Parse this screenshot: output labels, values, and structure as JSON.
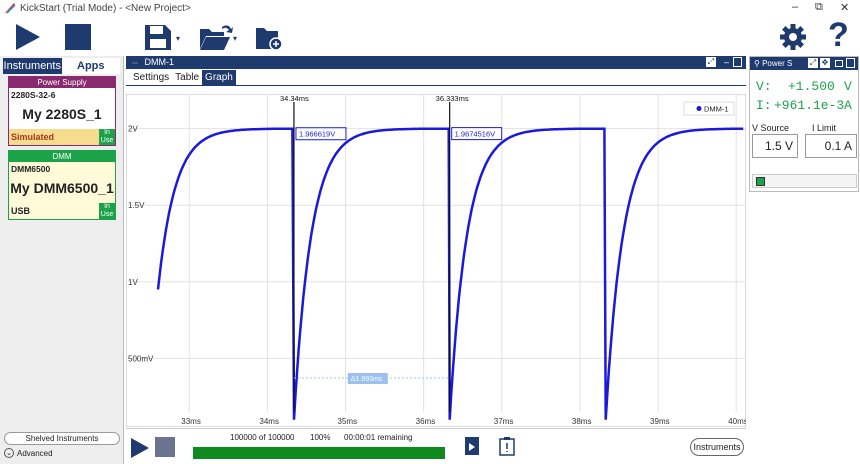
{
  "window": {
    "title": "KickStart (Trial Mode) - <New Project>",
    "minimize": "–",
    "restore": "⧉",
    "close": "✕"
  },
  "toolbar": {
    "help": "?"
  },
  "sidebar": {
    "tabs": [
      {
        "label": "Instruments"
      },
      {
        "label": "Apps"
      }
    ],
    "instruments": [
      {
        "type": "Power Supply",
        "model": "2280S-32-6",
        "name": "My 2280S_1",
        "connection": "Simulated",
        "status": "In Use",
        "color": "#8a2a6e"
      },
      {
        "type": "DMM",
        "model": "DMM6500",
        "name": "My DMM6500_1",
        "connection": "USB",
        "status": "In Use",
        "color": "#1ca34a"
      }
    ],
    "shelved_label": "Shelved Instruments",
    "advanced_label": "Advanced"
  },
  "dmm": {
    "title": "DMM-1",
    "tabs": [
      "Settings",
      "Table",
      "Graph"
    ],
    "selected_tab": "Graph",
    "progress": {
      "text": "100000 of 100000",
      "percent_text": "100%",
      "remaining": "00:00:01 remaining",
      "fraction": 1.0
    },
    "instruments_button": "Instruments"
  },
  "chart_data": {
    "type": "line",
    "series": [
      {
        "name": "DMM-1",
        "color": "#1a1adb"
      }
    ],
    "x_ticks": [
      "33ms",
      "34ms",
      "35ms",
      "36ms",
      "37ms",
      "38ms",
      "39ms",
      "40ms"
    ],
    "y_ticks": [
      "2V",
      "1.5V",
      "1V",
      "500mV"
    ],
    "xlim": [
      32.6,
      40.1
    ],
    "ylim": [
      0.15,
      2.2
    ],
    "cycle_starts_ms": [
      32.6,
      34.34,
      36.333,
      38.33
    ],
    "cycle_max_v": 2.0,
    "cycle_min_v": 0.1,
    "cursors": [
      {
        "x_label": "34.34ms",
        "value_label": "1.966619V",
        "x": 34.34,
        "y": 1.966619
      },
      {
        "x_label": "36.333ms",
        "value_label": "1.9674516V",
        "x": 36.333,
        "y": 1.9674516
      }
    ],
    "delta_label": "Δ1.993ms"
  },
  "power_supply": {
    "title": "Power S",
    "v_label": "V:",
    "v_value": "+1.500",
    "v_unit": "V",
    "i_label": "I:",
    "i_value": "+961.1e-3",
    "i_unit": "A",
    "vsource_label": "V Source",
    "vsource_value": "1.5 V",
    "ilimit_label": "I Limit",
    "ilimit_value": "0.1 A"
  }
}
